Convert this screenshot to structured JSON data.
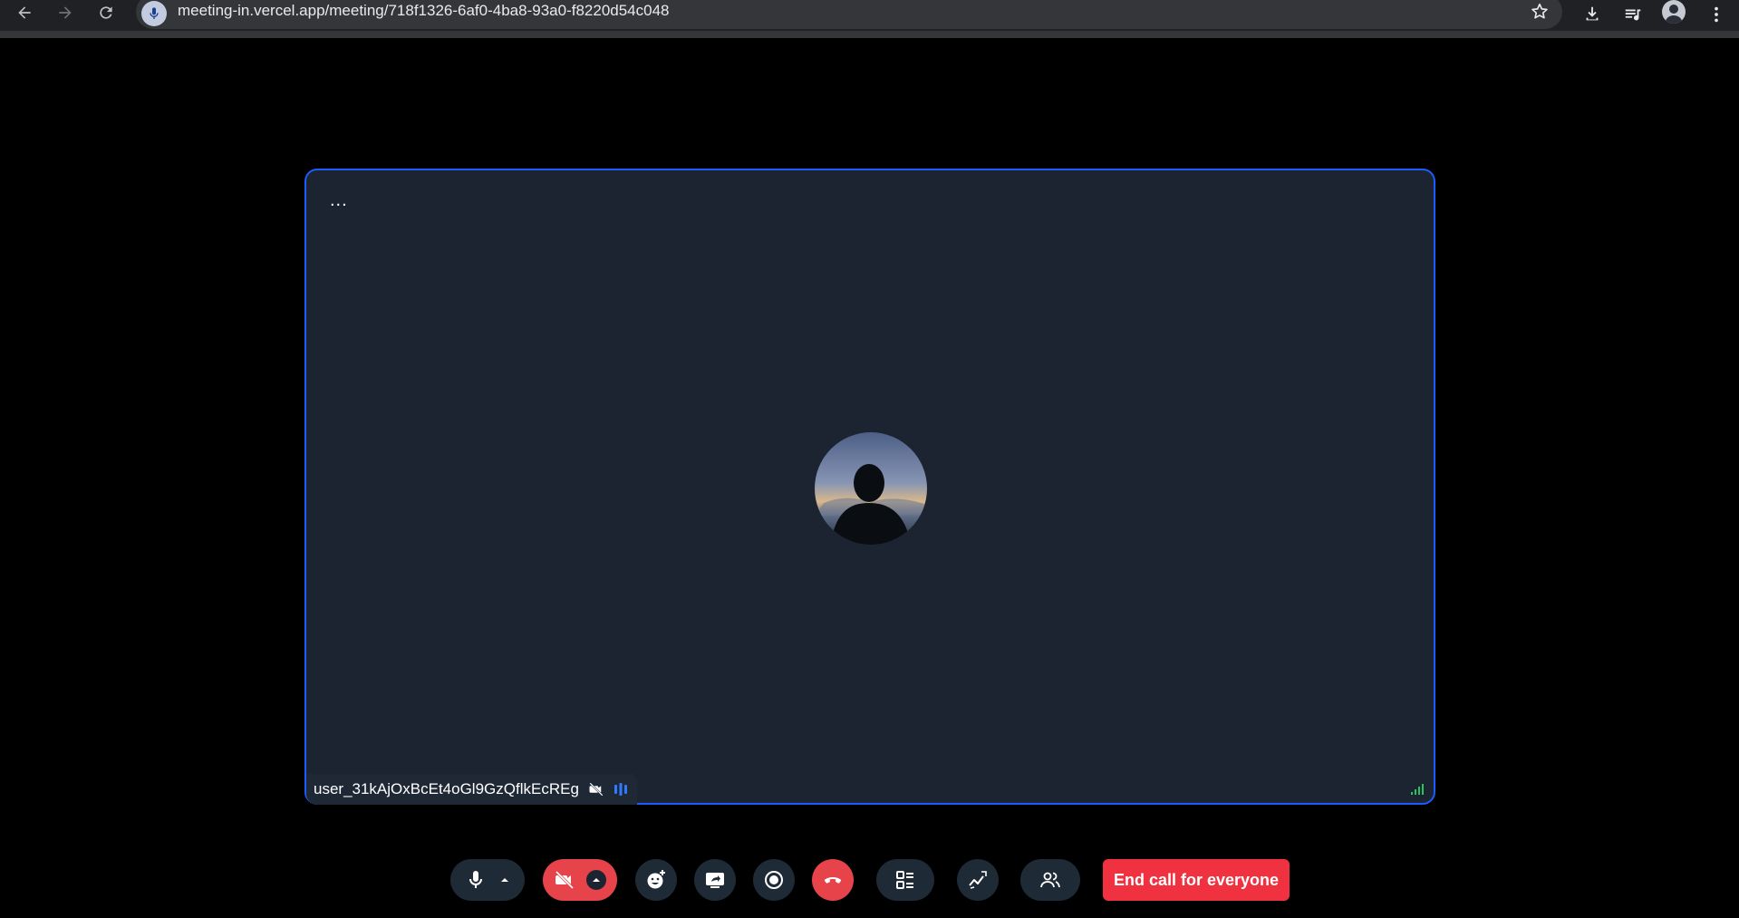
{
  "browser": {
    "url": "meeting-in.vercel.app/meeting/718f1326-6af0-4ba8-93a0-f8220d54c048",
    "icons": [
      "back-arrow-icon",
      "forward-arrow-icon",
      "reload-icon",
      "microphone-icon",
      "star-icon",
      "download-icon",
      "media-control-icon",
      "profile-avatar",
      "more-vert-icon"
    ]
  },
  "meeting": {
    "participant": {
      "name": "user_31kAjOxBcEt4oGl9GzQflkEcREg",
      "camera": "off",
      "audio_indicator": "speaking"
    },
    "menu_label": "...",
    "stage_border_color": "#1a5cff",
    "stage_background": "#1b2430"
  },
  "controls": {
    "end_call_everyone_label": "End call for everyone",
    "buttons": [
      "mic",
      "webcam-off",
      "reactions",
      "screen-share",
      "record",
      "leave-call",
      "layout",
      "whiteboard",
      "participants"
    ],
    "accent_red": "#e6444a",
    "end_button_color": "#f0313f"
  }
}
